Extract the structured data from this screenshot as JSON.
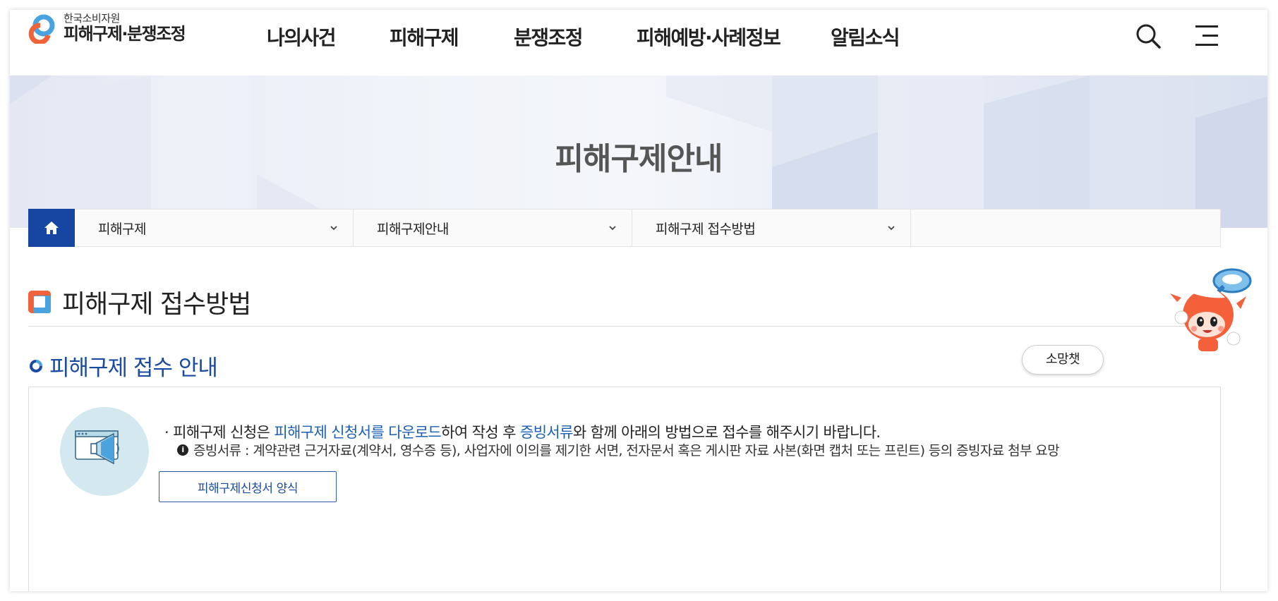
{
  "header": {
    "logo_sub": "한국소비자원",
    "logo_main": "피해구제·분쟁조정",
    "nav": [
      "나의사건",
      "피해구제",
      "분쟁조정",
      "피해예방·사례정보",
      "알림소식"
    ],
    "icons": {
      "search": "search-icon",
      "menu": "hamburger-menu-icon"
    }
  },
  "visual": {
    "title": "피해구제안내"
  },
  "breadcrumb": {
    "home_icon": "home-icon",
    "items": [
      "피해구제",
      "피해구제안내",
      "피해구제 접수방법"
    ]
  },
  "content": {
    "page_heading": "피해구제 접수방법",
    "section_heading": "피해구제 접수 안내",
    "line1_prefix": "· 피해구제 신청은 ",
    "line1_link1": "피해구제 신청서를 다운로드",
    "line1_mid": "하여 작성 후 ",
    "line1_link2": "증빙서류",
    "line1_suffix": "와 함께 아래의 방법으로 접수를 해주시기 바랍니다.",
    "info_icon_text": "i",
    "line2": "증빙서류 : 계약관련 근거자료(계약서, 영수증 등), 사업자에 이의를 제기한 서면, 전자문서 혹은 게시판 자료 사본(화면 캡처 또는 프린트) 등의 증빙자료 첨부 요망",
    "form_button": "피해구제신청서 양식"
  },
  "chatbot": {
    "label": "소망챗"
  },
  "colors": {
    "brand_blue": "#1746a2",
    "link_blue": "#1a5fb4",
    "brand_orange": "#f0623a",
    "light_blue": "#4aa3df"
  }
}
